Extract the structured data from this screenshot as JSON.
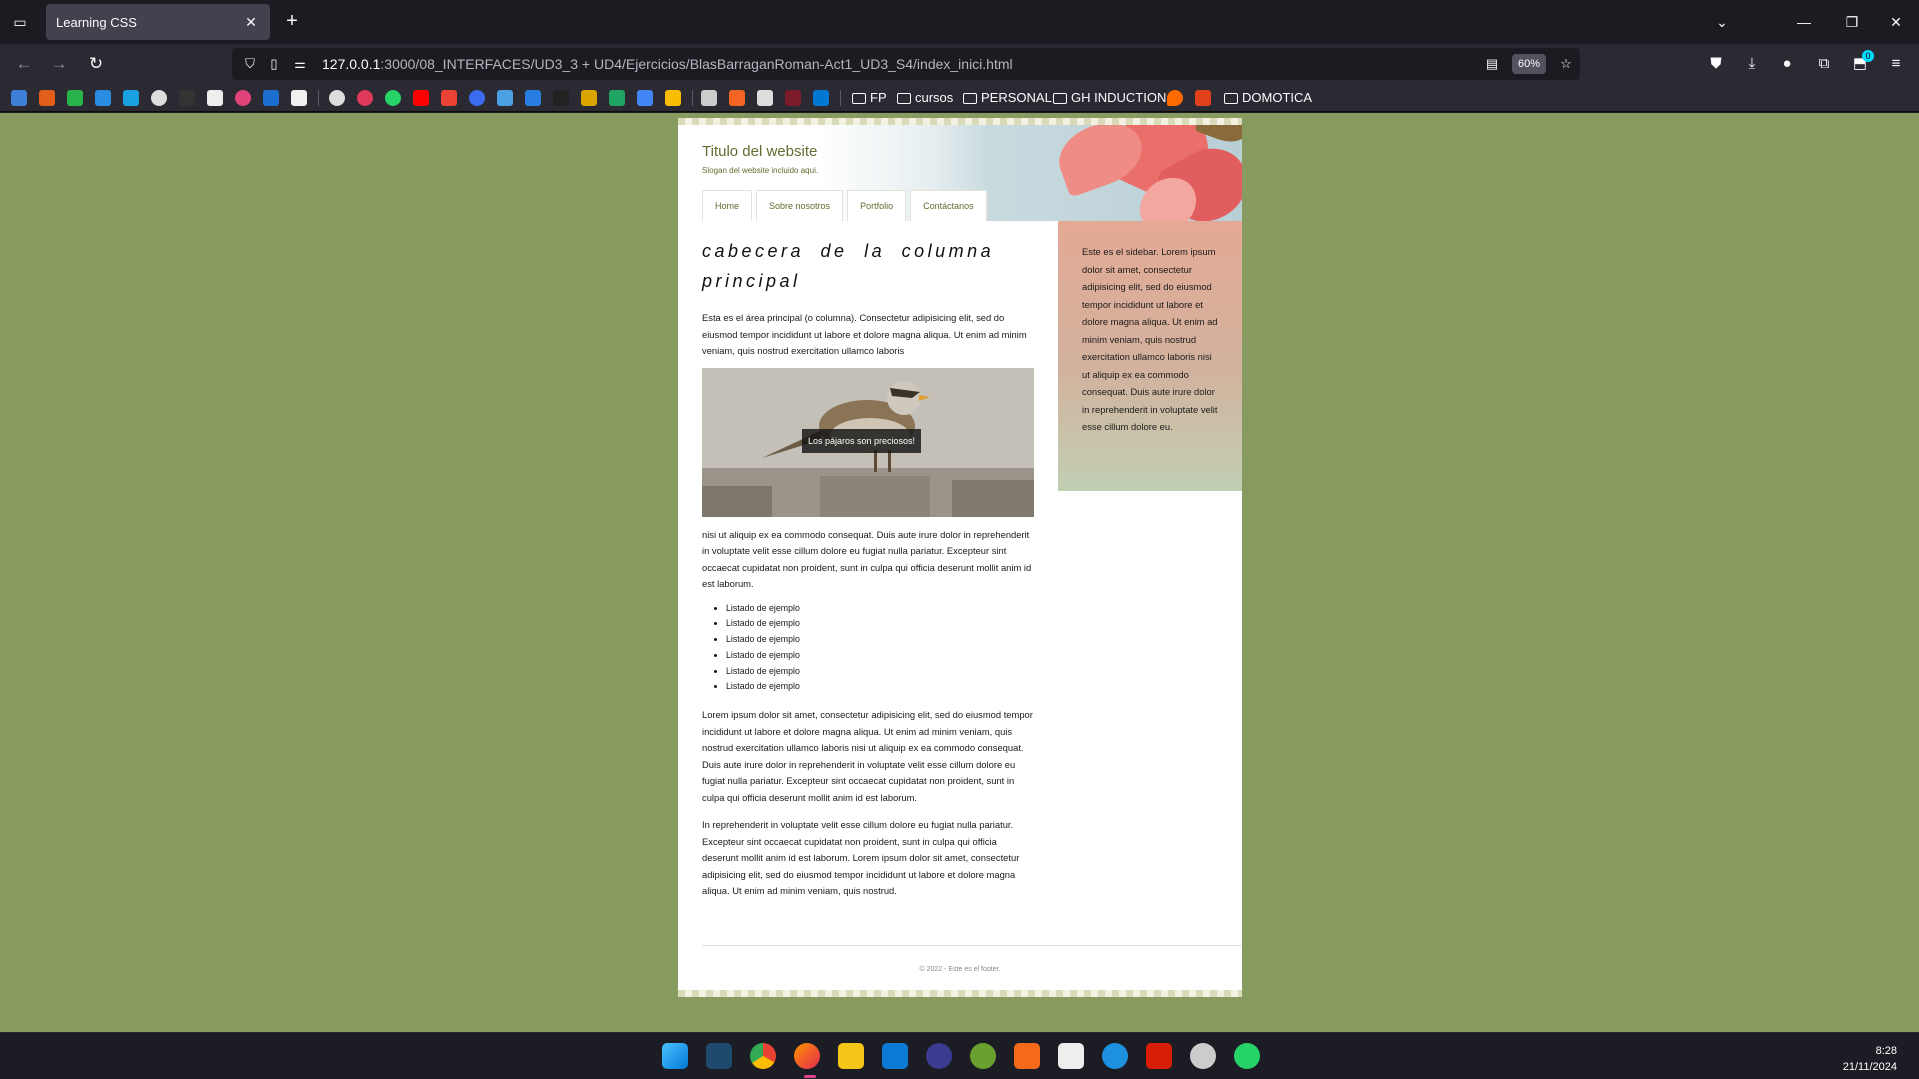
{
  "browser": {
    "tab_title": "Learning CSS",
    "url_host": "127.0.0.1",
    "url_path": ":3000/08_INTERFACES/UD3_3 + UD4/Ejercicios/BlasBarraganRoman-Act1_UD3_S4/index_inici.html",
    "zoom": "60%",
    "extension_badge": "0"
  },
  "bookmarks": {
    "folders": [
      "FP",
      "cursos",
      "PERSONAL",
      "GH INDUCTION",
      "DOMOTICA"
    ]
  },
  "site": {
    "title": "Titulo del website",
    "slogan": "Slogan del website incluido aqui.",
    "menu": [
      "Home",
      "Sobre nosotros",
      "Portfolio",
      "Contáctanos"
    ],
    "main_heading": "cabecera de la columna principal",
    "intro": "Esta es el área principal (o columna). Consectetur adipisicing elit, sed do eiusmod tempor incididunt ut labore et dolore magna aliqua. Ut enim ad minim veniam, quis nostrud exercitation ullamco laboris",
    "image_caption": "Los pájaros son preciosos!",
    "after_image": "nisi ut aliquip ex ea commodo consequat. Duis aute irure dolor in reprehenderit in voluptate velit esse cillum dolore eu fugiat nulla pariatur. Excepteur sint occaecat cupidatat non proident, sunt in culpa qui officia deserunt mollit anim id est laborum.",
    "list_items": [
      "Listado de ejemplo",
      "Listado de ejemplo",
      "Listado de ejemplo",
      "Listado de ejemplo",
      "Listado de ejemplo",
      "Listado de ejemplo"
    ],
    "paragraph_2": "Lorem ipsum dolor sit amet, consectetur adipisicing elit, sed do eiusmod tempor incididunt ut labore et dolore magna aliqua. Ut enim ad minim veniam, quis nostrud exercitation ullamco laboris nisi ut aliquip ex ea commodo consequat. Duis aute irure dolor in reprehenderit in voluptate velit esse cillum dolore eu fugiat nulla pariatur. Excepteur sint occaecat cupidatat non proident, sunt in culpa qui officia deserunt mollit anim id est laborum.",
    "paragraph_3": "In reprehenderit in voluptate velit esse cillum dolore eu fugiat nulla pariatur. Excepteur sint occaecat cupidatat non proident, sunt in culpa qui officia deserunt mollit anim id est laborum. Lorem ipsum dolor sit amet, consectetur adipisicing elit, sed do eiusmod tempor incididunt ut labore et dolore magna aliqua. Ut enim ad minim veniam, quis nostrud.",
    "sidebar": "Este es el sidebar. Lorem ipsum dolor sit amet, consectetur adipisicing elit, sed do eiusmod tempor incididunt ut labore et dolore magna aliqua. Ut enim ad minim veniam, quis nostrud exercitation ullamco laboris nisi ut aliquip ex ea commodo consequat. Duis aute irure dolor in reprehenderit in voluptate velit esse cillum dolore eu.",
    "footer": "© 2022 - Este es el footer."
  },
  "taskbar": {
    "time": "8:28",
    "date": "21/11/2024"
  },
  "colors": {
    "page_background": "#879a5f",
    "accent_text": "#5e6e2e",
    "browser_chrome": "#2b2a33"
  }
}
